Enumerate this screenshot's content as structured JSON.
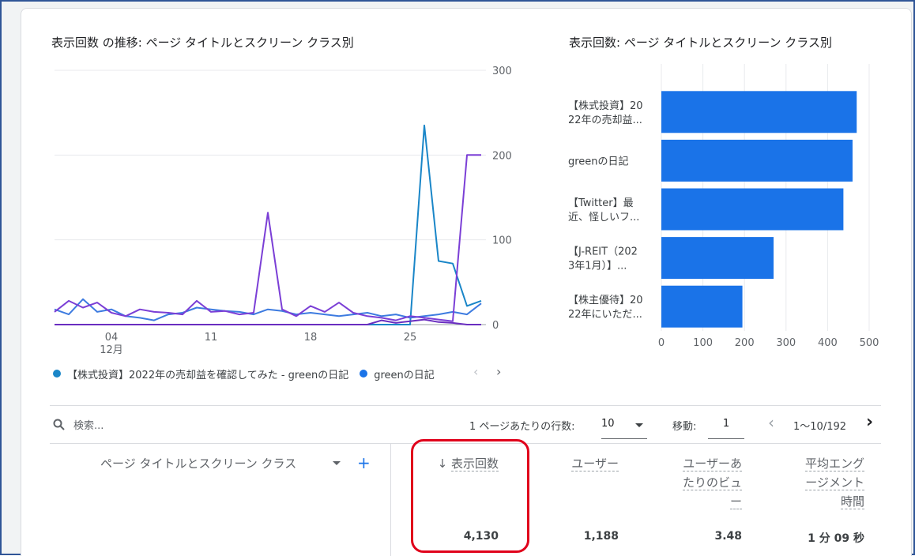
{
  "line_chart": {
    "title": "表示回数 の推移: ページ タイトルとスクリーン クラス別",
    "y_ticks": [
      "300",
      "200",
      "100",
      "0"
    ],
    "x_ticks": [
      {
        "label": "04",
        "sub": "12月"
      },
      {
        "label": "11",
        "sub": ""
      },
      {
        "label": "18",
        "sub": ""
      },
      {
        "label": "25",
        "sub": ""
      }
    ],
    "legend": [
      {
        "label": "【株式投資】2022年の売却益を確認してみた - greenの日記",
        "color": "#1a73c8"
      },
      {
        "label": "greenの日記",
        "color": "#1a73e8"
      }
    ],
    "legend_prev": "‹",
    "legend_next": "›"
  },
  "bar_chart": {
    "title": "表示回数: ページ タイトルとスクリーン クラス別",
    "x_ticks": [
      "0",
      "100",
      "200",
      "300",
      "400",
      "500"
    ]
  },
  "chart_data": [
    {
      "type": "line",
      "title": "表示回数 の推移: ページ タイトルとスクリーン クラス別",
      "x": [
        "11/30",
        "12/1",
        "12/2",
        "12/3",
        "12/4",
        "12/5",
        "12/6",
        "12/7",
        "12/8",
        "12/9",
        "12/10",
        "12/11",
        "12/12",
        "12/13",
        "12/14",
        "12/15",
        "12/16",
        "12/17",
        "12/18",
        "12/19",
        "12/20",
        "12/21",
        "12/22",
        "12/23",
        "12/24",
        "12/25",
        "12/26",
        "12/27",
        "12/28",
        "12/29",
        "12/30"
      ],
      "ylim": [
        0,
        300
      ],
      "series": [
        {
          "name": "【株式投資】2022年の売却益を確認してみた - greenの日記",
          "color": "#1a86c8",
          "values": [
            0,
            0,
            0,
            0,
            0,
            0,
            0,
            0,
            0,
            0,
            0,
            0,
            0,
            0,
            0,
            0,
            0,
            0,
            0,
            0,
            0,
            0,
            0,
            0,
            0,
            0,
            235,
            75,
            72,
            22,
            28
          ]
        },
        {
          "name": "greenの日記",
          "color": "#3d7be0",
          "values": [
            18,
            12,
            30,
            15,
            18,
            10,
            8,
            5,
            12,
            14,
            20,
            18,
            16,
            15,
            12,
            18,
            16,
            12,
            14,
            12,
            10,
            12,
            14,
            10,
            12,
            8,
            10,
            12,
            15,
            12,
            25
          ]
        },
        {
          "color": "#7b3fd6",
          "values": [
            15,
            28,
            20,
            26,
            14,
            10,
            18,
            15,
            14,
            12,
            28,
            15,
            16,
            12,
            14,
            132,
            18,
            10,
            22,
            15,
            26,
            14,
            10,
            8,
            5,
            10,
            8,
            6,
            4,
            200,
            200
          ]
        },
        {
          "color": "#6a2ec0",
          "values": [
            0,
            0,
            0,
            0,
            0,
            0,
            0,
            0,
            0,
            0,
            0,
            0,
            0,
            0,
            0,
            0,
            0,
            0,
            0,
            0,
            0,
            0,
            0,
            5,
            2,
            4,
            6,
            3,
            2,
            0,
            0
          ]
        }
      ]
    },
    {
      "type": "bar",
      "title": "表示回数: ページ タイトルとスクリーン クラス別",
      "orientation": "horizontal",
      "categories": [
        "【株式投資】2022年の売却益...",
        "greenの日記",
        "【Twitter】最近、怪しいフ...",
        "【J-REIT（2023年1月）】...",
        "【株主優待】2022年にいただ..."
      ],
      "category_lines": [
        [
          "【株式投資】20",
          "22年の売却益..."
        ],
        [
          "greenの日記"
        ],
        [
          "【Twitter】最",
          "近、怪しいフ..."
        ],
        [
          "【J-REIT（202",
          "3年1月）】..."
        ],
        [
          "【株主優待】20",
          "22年にいただ..."
        ]
      ],
      "values": [
        470,
        460,
        438,
        270,
        195
      ],
      "xlim": [
        0,
        500
      ],
      "color": "#1a73e8"
    }
  ],
  "table": {
    "search_placeholder": "検索...",
    "rows_per_page_label": "1 ページあたりの行数:",
    "rows_per_page_value": "10",
    "goto_label": "移動:",
    "goto_value": "1",
    "range_text": "1〜10/192",
    "prev_icon": "‹",
    "next_icon": "›",
    "dimension_header": "ページ タイトルとスクリーン クラス",
    "add_icon": "+",
    "sort_icon": "↓",
    "columns": [
      {
        "label_lines": [
          "表示回数"
        ],
        "total": "4,130"
      },
      {
        "label_lines": [
          "ユーザー"
        ],
        "total": "1,188"
      },
      {
        "label_lines": [
          "ユーザーあ",
          "たりのビュ",
          "ー"
        ],
        "total": "3.48"
      },
      {
        "label_lines": [
          "平均エング",
          "ージメント",
          "時間"
        ],
        "total": "1 分 09 秒"
      }
    ]
  }
}
